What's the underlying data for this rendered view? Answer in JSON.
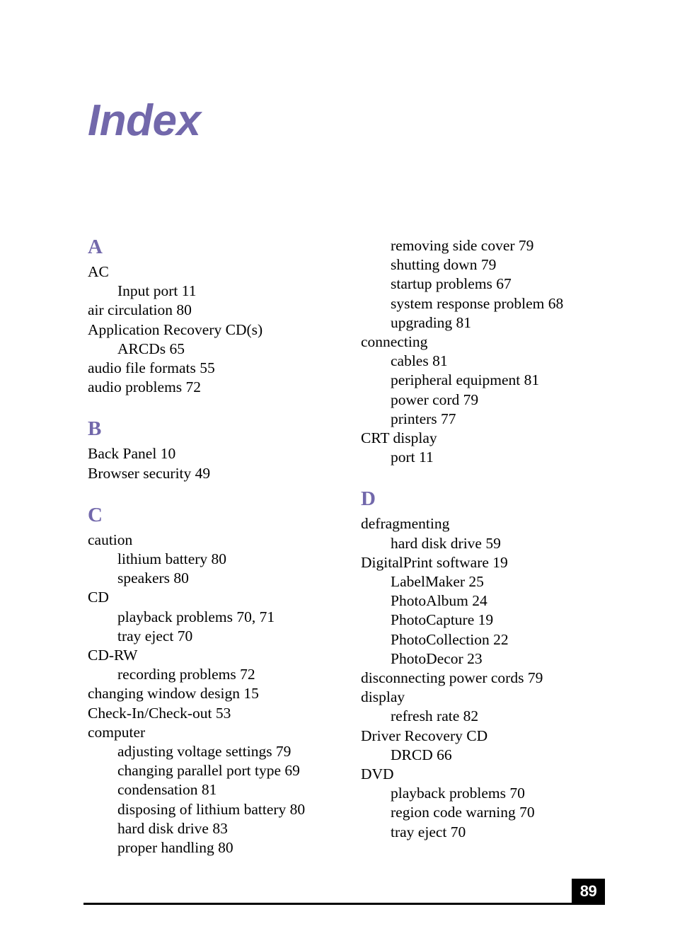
{
  "document": {
    "title": "Index",
    "accent_color": "#7268ab",
    "text_color": "#000000",
    "background_color": "#ffffff"
  },
  "footer": {
    "page_number": "89",
    "page_number_box_color": "#000000",
    "page_number_text_color": "#ffffff"
  },
  "index": {
    "columns": [
      {
        "name": "left-column",
        "sections": [
          {
            "letter": "A",
            "entries": [
              {
                "text": "AC",
                "level": 1
              },
              {
                "text": "Input port 11",
                "level": 2
              },
              {
                "text": "air circulation 80",
                "level": 1
              },
              {
                "text": "Application Recovery CD(s)",
                "level": 1
              },
              {
                "text": "ARCDs 65",
                "level": 2
              },
              {
                "text": "audio file formats 55",
                "level": 1
              },
              {
                "text": "audio problems 72",
                "level": 1
              }
            ]
          },
          {
            "letter": "B",
            "entries": [
              {
                "text": "Back Panel 10",
                "level": 1
              },
              {
                "text": "Browser security 49",
                "level": 1
              }
            ]
          },
          {
            "letter": "C",
            "entries": [
              {
                "text": "caution",
                "level": 1
              },
              {
                "text": "lithium battery 80",
                "level": 2
              },
              {
                "text": "speakers 80",
                "level": 2
              },
              {
                "text": "CD",
                "level": 1
              },
              {
                "text": "playback problems 70, 71",
                "level": 2
              },
              {
                "text": "tray eject 70",
                "level": 2
              },
              {
                "text": "CD-RW",
                "level": 1
              },
              {
                "text": "recording problems 72",
                "level": 2
              },
              {
                "text": "changing window design 15",
                "level": 1
              },
              {
                "text": "Check-In/Check-out 53",
                "level": 1
              },
              {
                "text": "computer",
                "level": 1
              },
              {
                "text": "adjusting voltage settings 79",
                "level": 2
              },
              {
                "text": "changing parallel port type 69",
                "level": 2
              },
              {
                "text": "condensation 81",
                "level": 2
              },
              {
                "text": "disposing of lithium battery 80",
                "level": 2
              },
              {
                "text": "hard disk drive 83",
                "level": 2
              },
              {
                "text": "proper handling 80",
                "level": 2
              }
            ]
          }
        ]
      },
      {
        "name": "right-column",
        "sections": [
          {
            "letter": "",
            "entries": [
              {
                "text": "removing side cover 79",
                "level": 2
              },
              {
                "text": "shutting down 79",
                "level": 2
              },
              {
                "text": "startup problems 67",
                "level": 2
              },
              {
                "text": "system response problem 68",
                "level": 2
              },
              {
                "text": "upgrading 81",
                "level": 2
              },
              {
                "text": "connecting",
                "level": 1
              },
              {
                "text": "cables 81",
                "level": 2
              },
              {
                "text": "peripheral equipment 81",
                "level": 2
              },
              {
                "text": "power cord 79",
                "level": 2
              },
              {
                "text": "printers 77",
                "level": 2
              },
              {
                "text": "CRT display",
                "level": 1
              },
              {
                "text": "port 11",
                "level": 2
              }
            ]
          },
          {
            "letter": "D",
            "entries": [
              {
                "text": "defragmenting",
                "level": 1
              },
              {
                "text": "hard disk drive 59",
                "level": 2
              },
              {
                "text": "DigitalPrint software 19",
                "level": 1
              },
              {
                "text": "LabelMaker 25",
                "level": 2
              },
              {
                "text": "PhotoAlbum 24",
                "level": 2
              },
              {
                "text": "PhotoCapture 19",
                "level": 2
              },
              {
                "text": "PhotoCollection 22",
                "level": 2
              },
              {
                "text": "PhotoDecor 23",
                "level": 2
              },
              {
                "text": "disconnecting power cords 79",
                "level": 1
              },
              {
                "text": "display",
                "level": 1
              },
              {
                "text": "refresh rate 82",
                "level": 2
              },
              {
                "text": "Driver Recovery CD",
                "level": 1
              },
              {
                "text": "DRCD 66",
                "level": 2
              },
              {
                "text": "DVD",
                "level": 1
              },
              {
                "text": "playback problems 70",
                "level": 2
              },
              {
                "text": "region code warning 70",
                "level": 2
              },
              {
                "text": "tray eject 70",
                "level": 2
              }
            ]
          }
        ]
      }
    ]
  }
}
